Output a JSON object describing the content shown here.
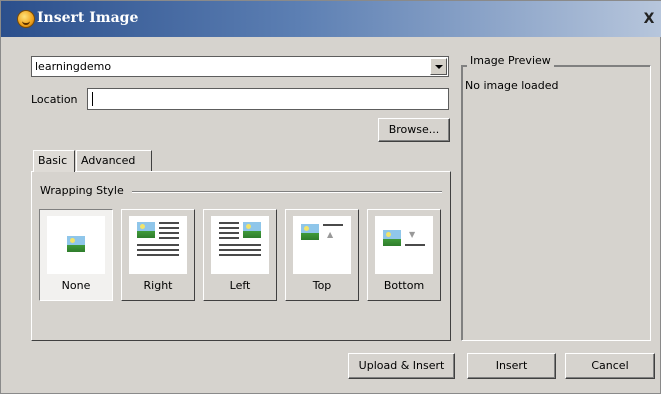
{
  "window": {
    "title": "Insert Image",
    "close_label": "X"
  },
  "source": {
    "selected": "learningdemo"
  },
  "location": {
    "label": "Location",
    "value": ""
  },
  "browse_label": "Browse...",
  "tabs": [
    {
      "label": "Basic",
      "active": true
    },
    {
      "label": "Advanced",
      "active": false
    }
  ],
  "wrapping": {
    "legend": "Wrapping Style",
    "options": [
      {
        "label": "None",
        "selected": true
      },
      {
        "label": "Right",
        "selected": false
      },
      {
        "label": "Left",
        "selected": false
      },
      {
        "label": "Top",
        "selected": false
      },
      {
        "label": "Bottom",
        "selected": false
      }
    ]
  },
  "preview": {
    "legend": "Image Preview",
    "status": "No image loaded"
  },
  "buttons": {
    "upload_insert": "Upload & Insert",
    "insert": "Insert",
    "cancel": "Cancel"
  },
  "colors": {
    "titlebar_start": "#2b4f8c",
    "titlebar_end": "#b7c6dc",
    "dialog_bg": "#d6d3ce"
  }
}
